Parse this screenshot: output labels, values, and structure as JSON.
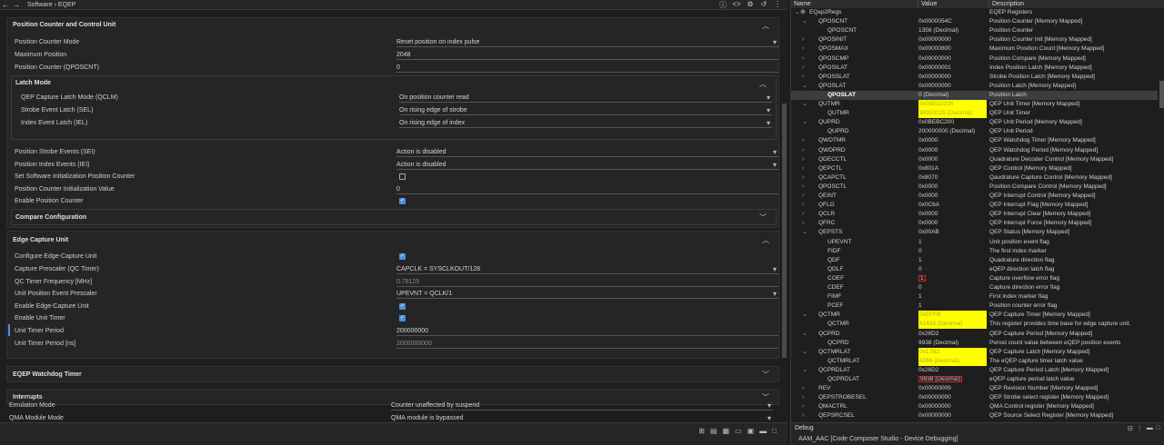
{
  "topbar": {
    "breadcrumb": "Software › EQEP",
    "back": "←",
    "forward": "→"
  },
  "pcc": {
    "title": "Position Counter and Control Unit",
    "rows": [
      {
        "label": "Position Counter Mode",
        "value": "Reset position on index pulse"
      },
      {
        "label": "Maximum Position",
        "value": "2048"
      },
      {
        "label": "Position Counter (QPOSCNT)",
        "value": "0"
      }
    ],
    "latch": {
      "title": "Latch Mode",
      "rows": [
        {
          "label": "QEP Capture Latch Mode (QCLM)",
          "value": "On position counter read"
        },
        {
          "label": "Strobe Event Latch (SEL)",
          "value": "On rising edge of strobe"
        },
        {
          "label": "Index Event Latch (IEL)",
          "value": "On rising edge of index"
        }
      ]
    },
    "rows2": [
      {
        "label": "Position Strobe Events (SEI)",
        "value": "Action is disabled"
      },
      {
        "label": "Position Index Events (IEI)",
        "value": "Action is disabled"
      },
      {
        "label": "Set Software Initialization Position Counter",
        "value": ""
      },
      {
        "label": "Position Counter Initialization Value",
        "value": "0"
      },
      {
        "label": "Enable Position Counter",
        "value": ""
      }
    ],
    "compare": "Compare Configuration"
  },
  "ecu": {
    "title": "Edge Capture Unit",
    "rows": [
      {
        "label": "Configure Edge-Capture Unit",
        "value": ""
      },
      {
        "label": "Capture Prescaler (QC Timer)",
        "value": "CAPCLK = SYSCLKOUT/128"
      },
      {
        "label": "QC Timer Frequency [MHz]",
        "value": "0.78125"
      },
      {
        "label": "Unit Position Event Prescaler",
        "value": "UPEVNT = QCLK/1"
      },
      {
        "label": "Enable Edge-Capture Unit",
        "value": ""
      },
      {
        "label": "Enable Unit Timer",
        "value": ""
      },
      {
        "label": "Unit Timer Period",
        "value": "200000000"
      },
      {
        "label": "Unit Timer Period [ns]",
        "value": "2000000000"
      }
    ]
  },
  "watchdog": "EQEP Watchdog Timer",
  "interrupts": "Interrupts",
  "tail": [
    {
      "label": "Emulation Mode",
      "value": "Counter unaffected by suspend"
    },
    {
      "label": "QMA Module Mode",
      "value": "QMA module is bypassed"
    }
  ],
  "registers": {
    "headers": [
      "Name",
      "Value",
      "Description"
    ],
    "rows": [
      {
        "n": "EQep2Regs",
        "v": "",
        "d": "EQEP Registers",
        "i": 0,
        "t": "v"
      },
      {
        "n": "QPOSCNT",
        "v": "0x0000054C",
        "d": "Position Counter  [Memory Mapped]",
        "i": 1,
        "t": "v"
      },
      {
        "n": "QPOSCNT",
        "v": "1356 (Decimal)",
        "d": "Position Counter",
        "i": 2,
        "t": ""
      },
      {
        "n": "QPOSINIT",
        "v": "0x00000000",
        "d": "Position Counter Init  [Memory Mapped]",
        "i": 1,
        "t": ">"
      },
      {
        "n": "QPOSMAX",
        "v": "0x00000800",
        "d": "Maximum Position Count  [Memory Mapped]",
        "i": 1,
        "t": ">"
      },
      {
        "n": "QPOSCMP",
        "v": "0x00000000",
        "d": "Position Compare  [Memory Mapped]",
        "i": 1,
        "t": ">"
      },
      {
        "n": "QPOSILAT",
        "v": "0x00000001",
        "d": "Index Position Latch  [Memory Mapped]",
        "i": 1,
        "t": ">"
      },
      {
        "n": "QPOSSLAT",
        "v": "0x00000000",
        "d": "Strobe Position Latch  [Memory Mapped]",
        "i": 1,
        "t": ">"
      },
      {
        "n": "QPOSLAT",
        "v": "0x00000000",
        "d": "Position Latch  [Memory Mapped]",
        "i": 1,
        "t": "v"
      },
      {
        "n": "QPOSLAT",
        "v": "0 (Decimal)",
        "d": "Position Latch",
        "i": 2,
        "t": "",
        "sel": true
      },
      {
        "n": "QUTMR",
        "v": "0x05EC0225",
        "d": "QEP Unit Timer  [Memory Mapped]",
        "i": 1,
        "t": "v",
        "hl": true
      },
      {
        "n": "QUTMR",
        "v": "99353125 (Decimal)",
        "d": "QEP Unit Timer",
        "i": 2,
        "t": "",
        "hl": true
      },
      {
        "n": "QUPRD",
        "v": "0x0BEBC200",
        "d": "QEP Unit Period  [Memory Mapped]",
        "i": 1,
        "t": "v"
      },
      {
        "n": "QUPRD",
        "v": "200000000 (Decimal)",
        "d": "QEP Unit Period",
        "i": 2,
        "t": ""
      },
      {
        "n": "QWDTMR",
        "v": "0x0000",
        "d": "QEP Watchdog Timer  [Memory Mapped]",
        "i": 1,
        "t": ">"
      },
      {
        "n": "QWDPRD",
        "v": "0x0000",
        "d": "QEP Watchdog Period  [Memory Mapped]",
        "i": 1,
        "t": ">"
      },
      {
        "n": "QDECCTL",
        "v": "0x0000",
        "d": "Quadrature Decoder Control  [Memory Mapped]",
        "i": 1,
        "t": ">"
      },
      {
        "n": "QEPCTL",
        "v": "0x801A",
        "d": "QEP Control  [Memory Mapped]",
        "i": 1,
        "t": ">"
      },
      {
        "n": "QCAPCTL",
        "v": "0x8070",
        "d": "Qaudrature Capture Control  [Memory Mapped]",
        "i": 1,
        "t": ">"
      },
      {
        "n": "QPOSCTL",
        "v": "0x0000",
        "d": "Position Compare Control  [Memory Mapped]",
        "i": 1,
        "t": ">"
      },
      {
        "n": "QEINT",
        "v": "0x0000",
        "d": "QEP Interrupt Control  [Memory Mapped]",
        "i": 1,
        "t": ">"
      },
      {
        "n": "QFLG",
        "v": "0x0C6A",
        "d": "QEP Interrupt Flag  [Memory Mapped]",
        "i": 1,
        "t": ">"
      },
      {
        "n": "QCLR",
        "v": "0x0000",
        "d": "QEP Interrupt Clear  [Memory Mapped]",
        "i": 1,
        "t": ">"
      },
      {
        "n": "QFRC",
        "v": "0x0000",
        "d": "QEP Interrupt Force  [Memory Mapped]",
        "i": 1,
        "t": ">"
      },
      {
        "n": "QEPSTS",
        "v": "0x00AB",
        "d": "QEP Status  [Memory Mapped]",
        "i": 1,
        "t": "v"
      },
      {
        "n": "UPEVNT",
        "v": "1",
        "d": "Unit position event flag",
        "i": 2,
        "t": ""
      },
      {
        "n": "FIDF",
        "v": "0",
        "d": "The first index marker",
        "i": 2,
        "t": ""
      },
      {
        "n": "QDF",
        "v": "1",
        "d": "Quadrature direction flag",
        "i": 2,
        "t": ""
      },
      {
        "n": "QDLF",
        "v": "0",
        "d": "eQEP direction latch flag",
        "i": 2,
        "t": ""
      },
      {
        "n": "COEF",
        "v": "1",
        "d": "Capture overflow error flag",
        "i": 2,
        "t": "",
        "red": true
      },
      {
        "n": "CDEF",
        "v": "0",
        "d": "Capture direction error flag",
        "i": 2,
        "t": ""
      },
      {
        "n": "FIMF",
        "v": "1",
        "d": "First index marker flag",
        "i": 2,
        "t": ""
      },
      {
        "n": "PCEF",
        "v": "1",
        "d": "Position counter error flag",
        "i": 2,
        "t": ""
      },
      {
        "n": "QCTMR",
        "v": "0xEFFB",
        "d": "QEP Capture Timer  [Memory Mapped]",
        "i": 1,
        "t": "v",
        "hl": true
      },
      {
        "n": "QCTMR",
        "v": "61435 (Decimal)",
        "d": "This register provides time base for edge capture unit.",
        "i": 2,
        "t": "",
        "hl": true
      },
      {
        "n": "QCPRD",
        "v": "0x26D2",
        "d": "QEP Capture Period  [Memory Mapped]",
        "i": 1,
        "t": "v"
      },
      {
        "n": "QCPRD",
        "v": "9938 (Decimal)",
        "d": "Period count value between  eQEP position events",
        "i": 2,
        "t": ""
      },
      {
        "n": "QCTMRLAT",
        "v": "0x17B2",
        "d": "QEP Capture Latch  [Memory Mapped]",
        "i": 1,
        "t": "v",
        "hl": true
      },
      {
        "n": "QCTMRLAT",
        "v": "6066 (Decimal)",
        "d": "The eQEP capture timer latch value",
        "i": 2,
        "t": "",
        "hl": true
      },
      {
        "n": "QCPRDLAT",
        "v": "0x26D2",
        "d": "QEP Capture Period Latch  [Memory Mapped]",
        "i": 1,
        "t": "v"
      },
      {
        "n": "QCPRDLAT",
        "v": "9938 (Decimal)",
        "d": "eQEP capture period latch value",
        "i": 2,
        "t": "",
        "red": true
      },
      {
        "n": "REV",
        "v": "0x00000009",
        "d": "QEP Revision Number  [Memory Mapped]",
        "i": 1,
        "t": ">"
      },
      {
        "n": "QEPSTROBESEL",
        "v": "0x00000000",
        "d": "QEP Strobe select register  [Memory Mapped]",
        "i": 1,
        "t": ">"
      },
      {
        "n": "QMACTRL",
        "v": "0x00000000",
        "d": "QMA Control register  [Memory Mapped]",
        "i": 1,
        "t": ">"
      },
      {
        "n": "QEPSRCSEL",
        "v": "0x00000000",
        "d": "QEP Source Select Register  [Memory Mapped]",
        "i": 1,
        "t": ">"
      }
    ]
  },
  "debug": {
    "tab": "Debug",
    "session": "AAM_AAC [Code Composer Studio - Device Debugging]"
  }
}
